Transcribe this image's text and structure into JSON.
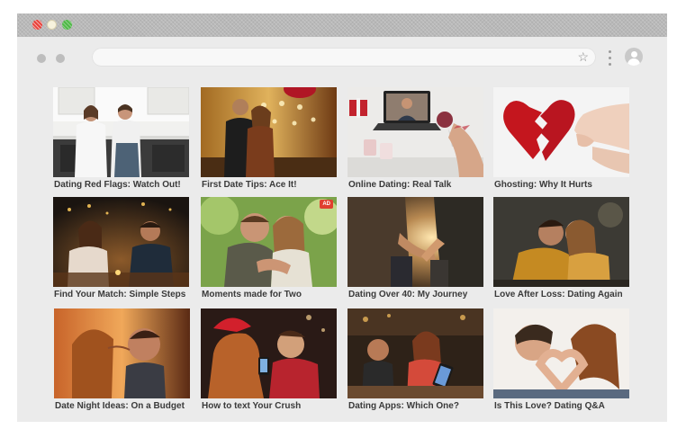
{
  "browser": {
    "window_controls": [
      "close",
      "minimize",
      "maximize"
    ],
    "nav_icons": [
      "back-icon",
      "forward-icon"
    ],
    "address_bar_value": "",
    "bookmark_icon": "star-icon",
    "menu_icon": "kebab-menu-icon",
    "profile_icon": "user-avatar-icon"
  },
  "cards": [
    {
      "caption": "Dating Red Flags: Watch Out!",
      "scene": "kitchen-couple-arguing"
    },
    {
      "caption": "First Date Tips: Ace It!",
      "scene": "couple-at-bar"
    },
    {
      "caption": "Online Dating: Real Talk",
      "scene": "laptop-video-call-wine"
    },
    {
      "caption": "Ghosting: Why It Hurts",
      "scene": "broken-paper-heart"
    },
    {
      "caption": "Find Your Match: Simple Steps",
      "scene": "candlelit-dinner"
    },
    {
      "caption": "Moments made for Two",
      "scene": "couple-embracing-outdoors",
      "badge": "AD"
    },
    {
      "caption": "Dating Over 40: My Journey",
      "scene": "holding-hands-sunset"
    },
    {
      "caption": "Love After Loss: Dating Again",
      "scene": "couple-forehead-touch"
    },
    {
      "caption": "Date Night Ideas: On a Budget",
      "scene": "couple-close-warm-light"
    },
    {
      "caption": "How to text Your Crush",
      "scene": "couple-with-phone"
    },
    {
      "caption": "Dating Apps: Which One?",
      "scene": "woman-looking-at-phone-restaurant"
    },
    {
      "caption": "Is This Love? Dating Q&A",
      "scene": "couple-hand-heart"
    }
  ],
  "colors": {
    "titlebar": "#b9b9b9",
    "window_bg": "#ebebeb",
    "caption_text": "#3a3a3a",
    "ad_badge": "#e0402f"
  }
}
